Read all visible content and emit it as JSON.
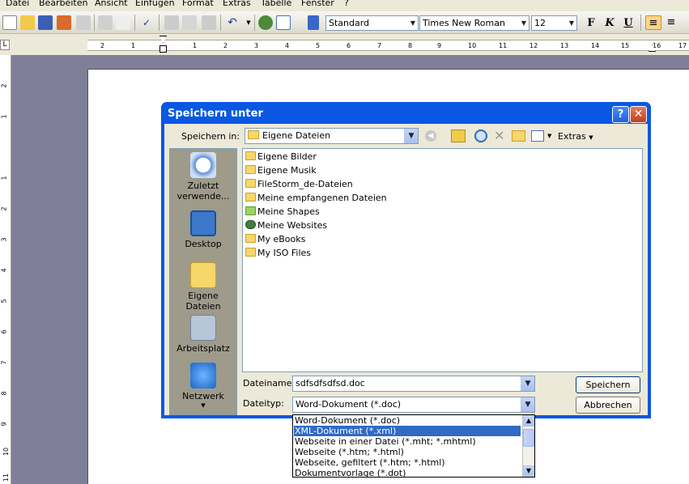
{
  "menu": [
    "Datei",
    "Bearbeiten",
    "Ansicht",
    "Einfügen",
    "Format",
    "Extras",
    "Tabelle",
    "Fenster",
    "?"
  ],
  "toolbar": {
    "style_value": "Standard",
    "font_value": "Times New Roman",
    "size_value": "12",
    "bold_label": "F",
    "italic_label": "K",
    "underline_label": "U"
  },
  "ruler": {
    "numbers": [
      "2",
      "1",
      "1",
      "2",
      "3",
      "4",
      "5",
      "6",
      "7",
      "8",
      "9",
      "10",
      "11",
      "12",
      "13",
      "14",
      "15",
      "16",
      "17"
    ],
    "vnumbers": [
      "2",
      "1",
      "1",
      "2",
      "3",
      "4",
      "5",
      "6",
      "7",
      "8",
      "9",
      "10",
      "11"
    ]
  },
  "dialog": {
    "title": "Speichern unter",
    "help": "?",
    "close": "✕",
    "save_in_label": "Speichern in:",
    "save_in_value": "Eigene Dateien",
    "extras_label": "Extras",
    "places": [
      {
        "label": "Zuletzt verwende...",
        "icon": "recent-icon"
      },
      {
        "label": "Desktop",
        "icon": "desktop-icon"
      },
      {
        "label": "Eigene Dateien",
        "icon": "my-documents-icon"
      },
      {
        "label": "Arbeitsplatz",
        "icon": "my-computer-icon"
      },
      {
        "label": "Netzwerk",
        "icon": "network-icon"
      }
    ],
    "files": [
      "Eigene Bilder",
      "Eigene Musik",
      "FileStorm_de-Dateien",
      "Meine empfangenen Dateien",
      "Meine Shapes",
      "Meine Websites",
      "My eBooks",
      "My ISO Files"
    ],
    "filename_label": "Dateiname:",
    "filename_value": "sdfsdfsdfsd.doc",
    "filetype_label": "Dateityp:",
    "filetype_value": "Word-Dokument (*.doc)",
    "save_button": "Speichern",
    "cancel_button": "Abbrechen"
  },
  "filetype_options": [
    "Word-Dokument (*.doc)",
    "XML-Dokument (*.xml)",
    "Webseite in einer Datei (*.mht; *.mhtml)",
    "Webseite (*.htm; *.html)",
    "Webseite, gefiltert (*.htm; *.html)",
    "Dokumentvorlage (*.dot)"
  ],
  "selected_option_index": 1,
  "colors": {
    "titlebar": "#0a57e4",
    "selection": "#316ac5",
    "dialog_bg": "#ece9d8"
  }
}
